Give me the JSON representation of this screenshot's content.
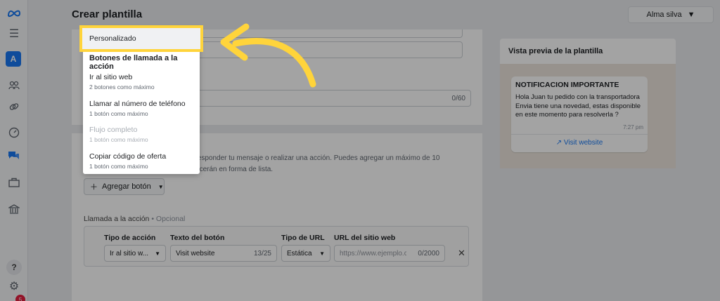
{
  "header": {
    "title": "Crear plantilla",
    "user_name": "Alma silva"
  },
  "rail": {
    "account_initial": "A",
    "help_label": "?",
    "notification_count": "5"
  },
  "form": {
    "header_counter": "0/60",
    "buttons_description": "dan responder tu mensaje o realizar una acción. Puedes agregar un máximo de 10 aparecerán en forma de lista.",
    "add_button_label": "Agregar botón",
    "cta_title": "Llamada a la acción",
    "cta_optional": "• Opcional",
    "columns": {
      "action_type": "Tipo de acción",
      "button_text": "Texto del botón",
      "url_type": "Tipo de URL",
      "website_url": "URL del sitio web"
    },
    "row": {
      "action_type_value": "Ir al sitio w...",
      "button_text_value": "Visit website",
      "button_text_count": "13/25",
      "url_type_value": "Estática",
      "url_placeholder": "https://www.ejemplo.cor",
      "url_count": "0/2000"
    }
  },
  "preview": {
    "title": "Vista previa de la plantilla",
    "message_header": "NOTIFICACION IMPORTANTE",
    "message_body": "Hola Juan tu pedido con la transportadora Envia tiene una novedad, estas disponible en este momento para resolverla ?",
    "time": "7:27 pm",
    "link_label": "Visit website"
  },
  "dropdown": {
    "highlighted": "Personalizado",
    "section_title": "Botones de llamada a la acción",
    "items": [
      {
        "label": "Ir al sitio web",
        "sub": "2 botones como máximo",
        "disabled": false
      },
      {
        "label": "Llamar al número de teléfono",
        "sub": "1 botón como máximo",
        "disabled": false
      },
      {
        "label": "Flujo completo",
        "sub": "1 botón como máximo",
        "disabled": true
      },
      {
        "label": "Copiar código de oferta",
        "sub": "1 botón como máximo",
        "disabled": false
      }
    ]
  },
  "colors": {
    "accent": "#1877f2",
    "highlight": "#ffd43b",
    "arrow": "#ffd43b"
  },
  "icons": [
    "meta-logo-icon",
    "menu-icon",
    "people-icon",
    "link-icon",
    "gauge-icon",
    "chat-icon",
    "briefcase-icon",
    "bank-icon",
    "help-icon",
    "settings-icon",
    "caret-down-icon",
    "plus-icon",
    "close-icon",
    "external-link-icon"
  ]
}
